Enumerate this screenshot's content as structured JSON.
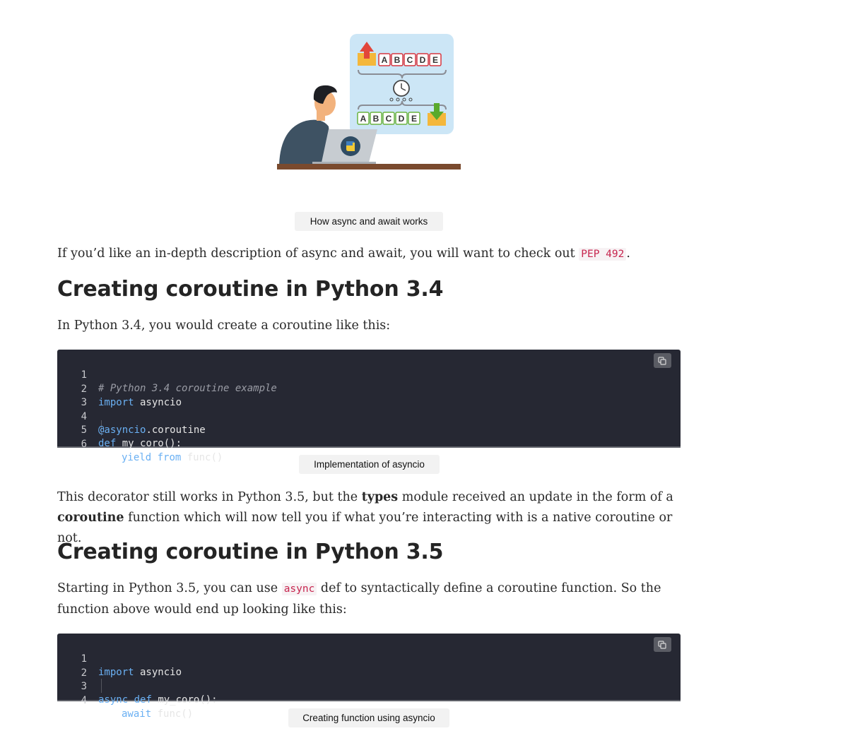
{
  "figure": {
    "illustration_icon": "developer-with-python-laptop-async-illustration",
    "letters_top": [
      "A",
      "B",
      "C",
      "D",
      "E"
    ],
    "letters_bottom": [
      "A",
      "B",
      "C",
      "D",
      "E"
    ],
    "caption": "How async and await works"
  },
  "intro": {
    "text_before": "If you’d like an in-depth description of async and await, you will want to check out ",
    "link_code": "PEP 492",
    "text_after": "."
  },
  "section34": {
    "heading": "Creating coroutine in Python 3.4",
    "intro": "In Python 3.4, you would create a coroutine like this:",
    "code": {
      "line_numbers": [
        "1",
        "2",
        "3",
        "4",
        "5",
        "6"
      ],
      "line1_comment": "# Python 3.4 coroutine example",
      "line2_kw": "import",
      "line2_rest": " asyncio",
      "line4_decorator": "@asyncio",
      "line4_rest": ".coroutine",
      "line5_kw": "def",
      "line5_rest": " my_coro():",
      "line6_kw1": "yield",
      "line6_kw2": "from",
      "line6_rest": " func()"
    },
    "caption": "Implementation of asyncio"
  },
  "explanation": {
    "part1": "This decorator still works in Python 3.5, but the ",
    "bold1": "types",
    "part2": " module received an update in the form of a ",
    "bold2": "coroutine",
    "part3": " function which will now tell you if what you’re interacting with is a native coroutine or not."
  },
  "section35": {
    "heading": "Creating coroutine in Python 3.5",
    "intro_before": "Starting in Python 3.5, you can use ",
    "intro_code": "async",
    "intro_after": " def to syntactically define a coroutine function. So the function above would end up looking like this:",
    "code": {
      "line_numbers": [
        "1",
        "2",
        "3",
        "4"
      ],
      "line1_kw": "import",
      "line1_rest": " asyncio",
      "line3_kw1": "async",
      "line3_kw2": "def",
      "line3_rest": " my_coro():",
      "line4_kw": "await",
      "line4_rest": " func()"
    },
    "caption": "Creating function using asyncio"
  },
  "icons": {
    "copy": "copy-icon"
  },
  "colors": {
    "code_bg": "#262833",
    "keyword": "#6ab0f3",
    "inline_code": "#c7254e",
    "caption_bg": "#f2f2f2"
  }
}
